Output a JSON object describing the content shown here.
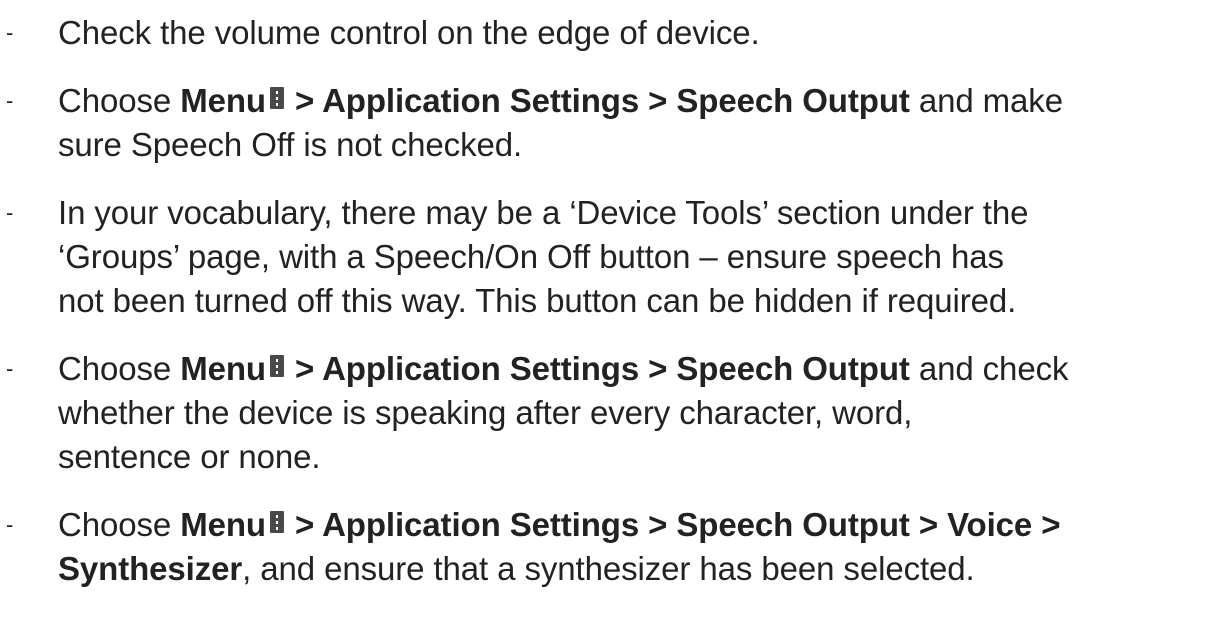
{
  "bullet": "-",
  "steps": [
    {
      "lines": [
        {
          "t1": "Check the volume control on the edge of device."
        }
      ]
    },
    {
      "lines": [
        {
          "pre": "Choose ",
          "b1": "Menu",
          "b2": " > Application Settings > Speech Output",
          "post": " and make"
        },
        {
          "t1": "sure Speech Off is not checked."
        }
      ]
    },
    {
      "lines": [
        {
          "t1": "In your vocabulary, there may be a ‘Device Tools’ section under the"
        },
        {
          "t1": "‘Groups’ page, with a Speech/On Off button – ensure speech has"
        },
        {
          "t1": "not been turned off this way. This button can be hidden if required."
        }
      ]
    },
    {
      "lines": [
        {
          "pre": "Choose ",
          "b1": "Menu",
          "b2": " > Application Settings > Speech Output",
          "post": " and check"
        },
        {
          "t1": "whether the device is speaking after every character, word,"
        },
        {
          "t1": "sentence or none."
        }
      ]
    },
    {
      "lines": [
        {
          "pre": "Choose ",
          "b1": "Menu",
          "b2": " > Application Settings > Speech Output > Voice >"
        },
        {
          "b1": "Synthesizer",
          "post": ", and ensure that a synthesizer has been selected."
        }
      ]
    }
  ],
  "icons": {
    "menu": "vertical-ellipsis-menu-icon"
  }
}
